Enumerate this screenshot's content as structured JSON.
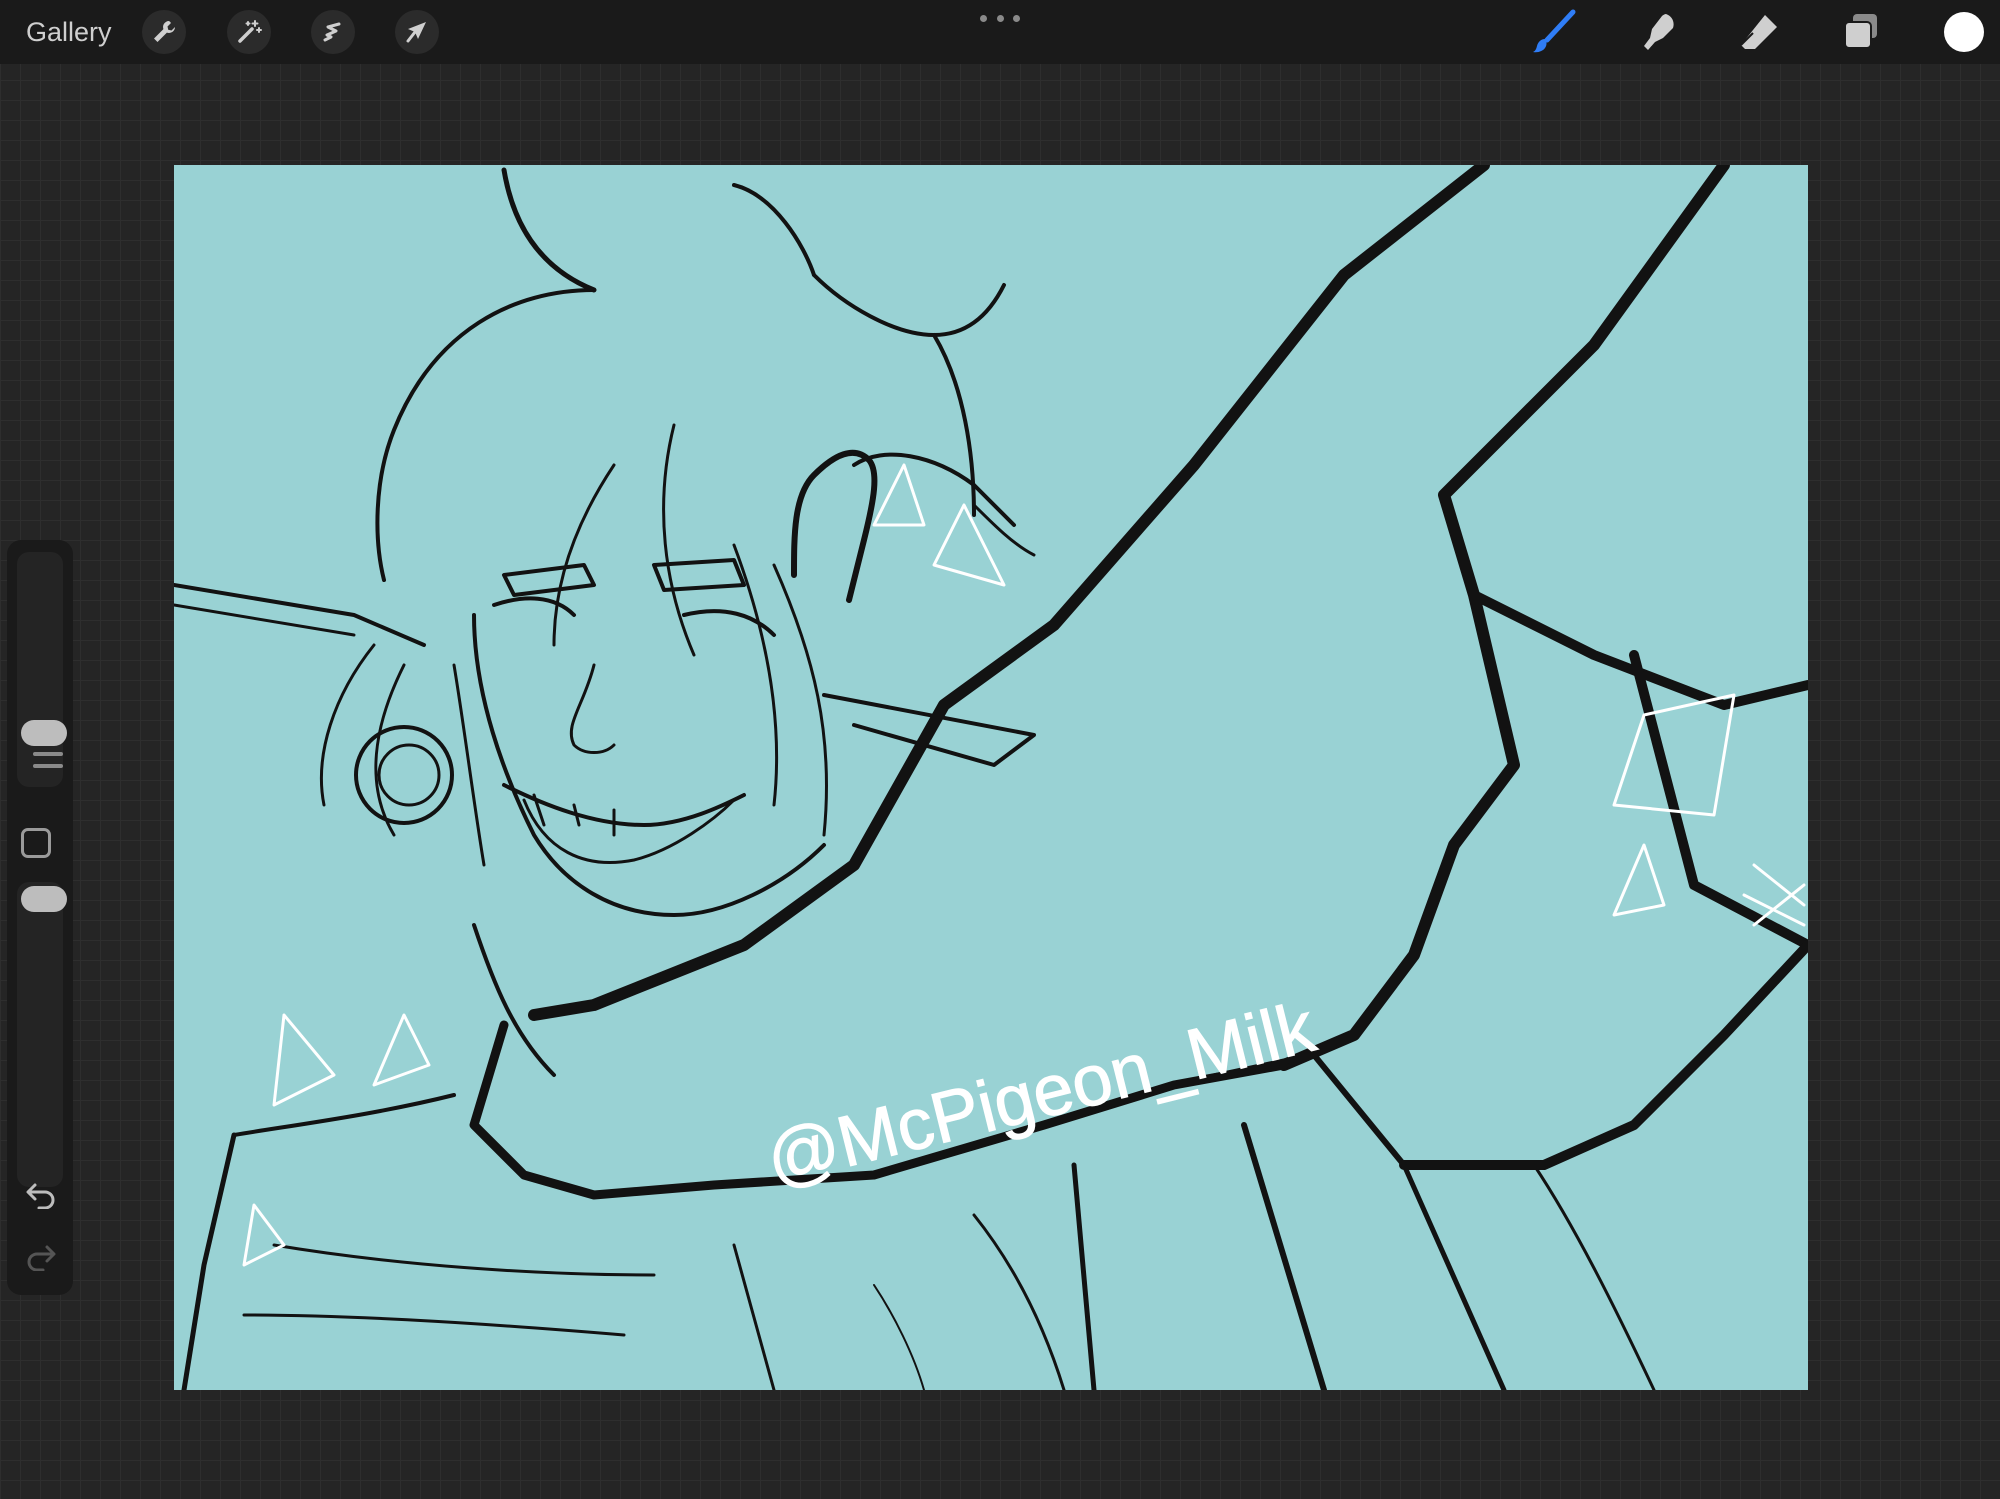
{
  "topbar": {
    "gallery_label": "Gallery",
    "tools_left": [
      {
        "name": "actions",
        "icon": "wrench-icon"
      },
      {
        "name": "adjustments",
        "icon": "magic-wand-icon"
      },
      {
        "name": "selection",
        "icon": "selection-s-icon"
      },
      {
        "name": "transform",
        "icon": "arrow-cursor-icon"
      }
    ],
    "more_icon": "more-dots-icon",
    "tools_right": [
      {
        "name": "brush",
        "icon": "brush-icon",
        "active": true
      },
      {
        "name": "smudge",
        "icon": "smudge-finger-icon"
      },
      {
        "name": "eraser",
        "icon": "eraser-icon"
      },
      {
        "name": "layers",
        "icon": "layers-icon"
      }
    ],
    "current_color": "#ffffff"
  },
  "canvas": {
    "background_color": "#99d2d4",
    "watermark_text": "@McPigeon_Milk"
  },
  "sidebar": {
    "brush_size_level": 0.38,
    "opacity_level": 0.95,
    "modify_icon": "square-modify-icon",
    "undo_icon": "undo-icon",
    "redo_icon": "redo-icon"
  },
  "colors": {
    "active_tool": "#2f7df6",
    "icon_default": "#cfcfcf",
    "background": "#252525",
    "bar": "#1a1a1a"
  }
}
